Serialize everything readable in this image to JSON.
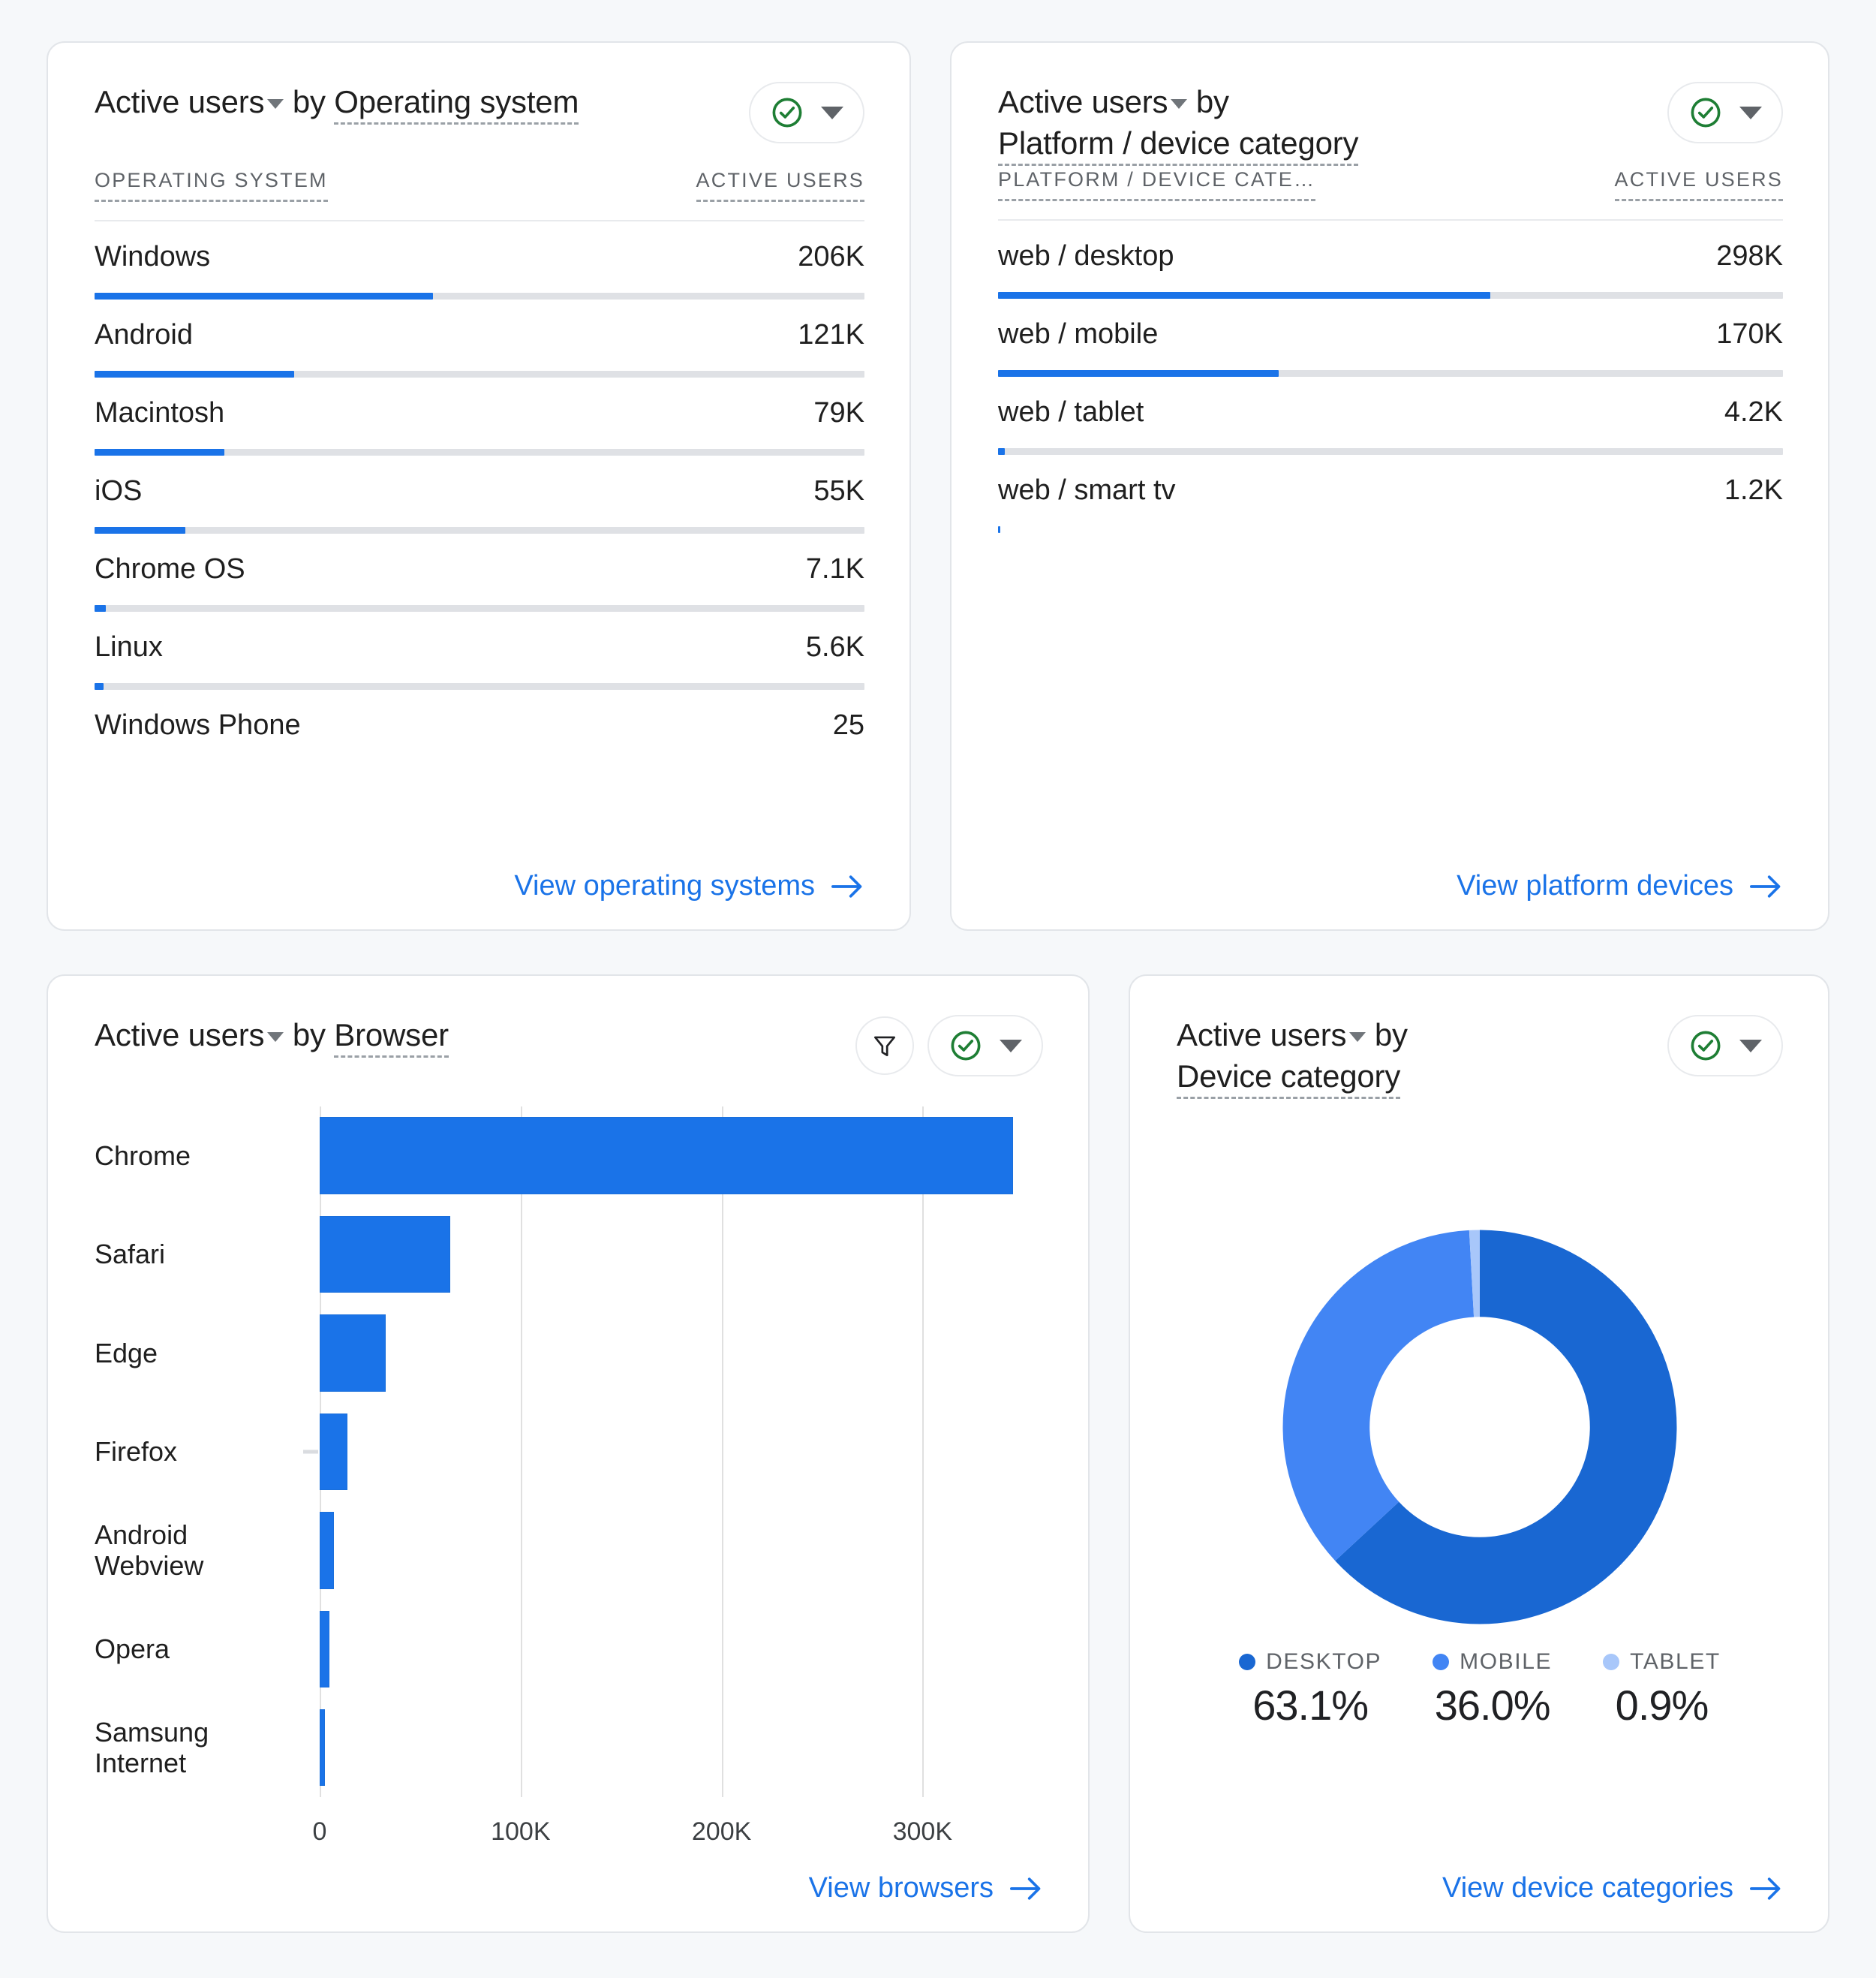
{
  "theme": {
    "page_bg": "#f6f8fa",
    "card_bg": "#ffffff",
    "accent_blue": "#1a73e8",
    "link_blue": "#1a73e8",
    "check_green": "#1e7e34",
    "track_gray": "#dfe1e5"
  },
  "cards": {
    "operating_system": {
      "metric_label": "Active users",
      "by_label": "by",
      "dimension_label": "Operating system",
      "status_icon": "circle-check-icon",
      "dropdown_icon": "chevron-down-icon",
      "columns": [
        "OPERATING SYSTEM",
        "ACTIVE USERS"
      ],
      "rows": [
        {
          "name": "Windows",
          "value": "206K",
          "pct": 44.0
        },
        {
          "name": "Android",
          "value": "121K",
          "pct": 25.9
        },
        {
          "name": "Macintosh",
          "value": "79K",
          "pct": 16.9
        },
        {
          "name": "iOS",
          "value": "55K",
          "pct": 11.8
        },
        {
          "name": "Chrome OS",
          "value": "7.1K",
          "pct": 1.5
        },
        {
          "name": "Linux",
          "value": "5.6K",
          "pct": 1.2
        },
        {
          "name": "Windows Phone",
          "value": "25",
          "pct": 0
        }
      ],
      "footer_link": "View operating systems"
    },
    "platform_device": {
      "metric_label": "Active users",
      "by_label": "by",
      "dimension_label": "Platform / device category",
      "status_icon": "circle-check-icon",
      "dropdown_icon": "chevron-down-icon",
      "columns": [
        "PLATFORM / DEVICE CATE…",
        "ACTIVE USERS"
      ],
      "rows": [
        {
          "name": "web / desktop",
          "value": "298K",
          "pct": 62.7
        },
        {
          "name": "web / mobile",
          "value": "170K",
          "pct": 35.8
        },
        {
          "name": "web / tablet",
          "value": "4.2K",
          "pct": 0.9
        },
        {
          "name": "web / smart tv",
          "value": "1.2K",
          "pct": 0.25
        }
      ],
      "footer_link": "View platform devices"
    },
    "browser": {
      "metric_label": "Active users",
      "by_label": "by",
      "dimension_label": "Browser",
      "filter_icon": "funnel-filter-icon",
      "status_icon": "circle-check-icon",
      "dropdown_icon": "chevron-down-icon",
      "footer_link": "View browsers"
    },
    "device_category": {
      "metric_label": "Active users",
      "by_label": "by",
      "dimension_label": "Device category",
      "status_icon": "circle-check-icon",
      "dropdown_icon": "chevron-down-icon",
      "footer_link": "View device categories"
    }
  },
  "chart_data": [
    {
      "type": "bar",
      "orientation": "horizontal",
      "title": "Active users by Browser",
      "categories": [
        "Chrome",
        "Safari",
        "Edge",
        "Firefox",
        "Android Webview",
        "Opera",
        "Samsung Internet"
      ],
      "values": [
        345000,
        65000,
        33000,
        14000,
        7000,
        5000,
        2500
      ],
      "xlabel": "",
      "ylabel": "",
      "xlim": [
        0,
        360000
      ],
      "xticks": [
        0,
        100000,
        200000,
        300000
      ],
      "xtick_labels": [
        "0",
        "100K",
        "200K",
        "300K"
      ],
      "grid": true,
      "legend": "none",
      "series_color": "#1a73e8"
    },
    {
      "type": "pie",
      "variant": "donut",
      "title": "Active users by Device category",
      "labels": [
        "DESKTOP",
        "MOBILE",
        "TABLET"
      ],
      "values": [
        63.1,
        36.0,
        0.9
      ],
      "value_labels": [
        "63.1%",
        "36.0%",
        "0.9%"
      ],
      "colors": [
        "#1967d2",
        "#4285f4",
        "#a8c7fa"
      ],
      "legend": "bottom"
    }
  ]
}
